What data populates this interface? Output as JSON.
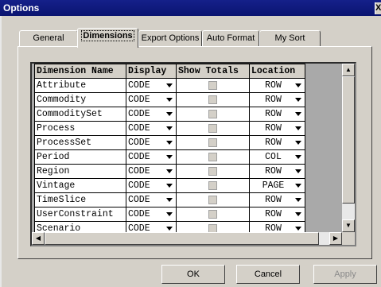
{
  "window": {
    "title": "Options",
    "close_label": "X"
  },
  "tabs": [
    {
      "label": "General"
    },
    {
      "label": "Dimensions"
    },
    {
      "label": "Export Options"
    },
    {
      "label": "Auto Format"
    },
    {
      "label": "My Sort"
    }
  ],
  "active_tab": "Dimensions",
  "grid": {
    "headers": [
      "Dimension Name",
      "Display",
      "Show Totals",
      "Location"
    ],
    "rows": [
      {
        "name": "Attribute",
        "display": "CODE",
        "location": "ROW"
      },
      {
        "name": "Commodity",
        "display": "CODE",
        "location": "ROW"
      },
      {
        "name": "CommoditySet",
        "display": "CODE",
        "location": "ROW"
      },
      {
        "name": "Process",
        "display": "CODE",
        "location": "ROW"
      },
      {
        "name": "ProcessSet",
        "display": "CODE",
        "location": "ROW"
      },
      {
        "name": "Period",
        "display": "CODE",
        "location": "COL"
      },
      {
        "name": "Region",
        "display": "CODE",
        "location": "ROW"
      },
      {
        "name": "Vintage",
        "display": "CODE",
        "location": "PAGE"
      },
      {
        "name": "TimeSlice",
        "display": "CODE",
        "location": "ROW"
      },
      {
        "name": "UserConstraint",
        "display": "CODE",
        "location": "ROW"
      },
      {
        "name": "Scenario",
        "display": "CODE",
        "location": "ROW"
      }
    ]
  },
  "buttons": {
    "ok": "OK",
    "cancel": "Cancel",
    "apply": "Apply"
  }
}
